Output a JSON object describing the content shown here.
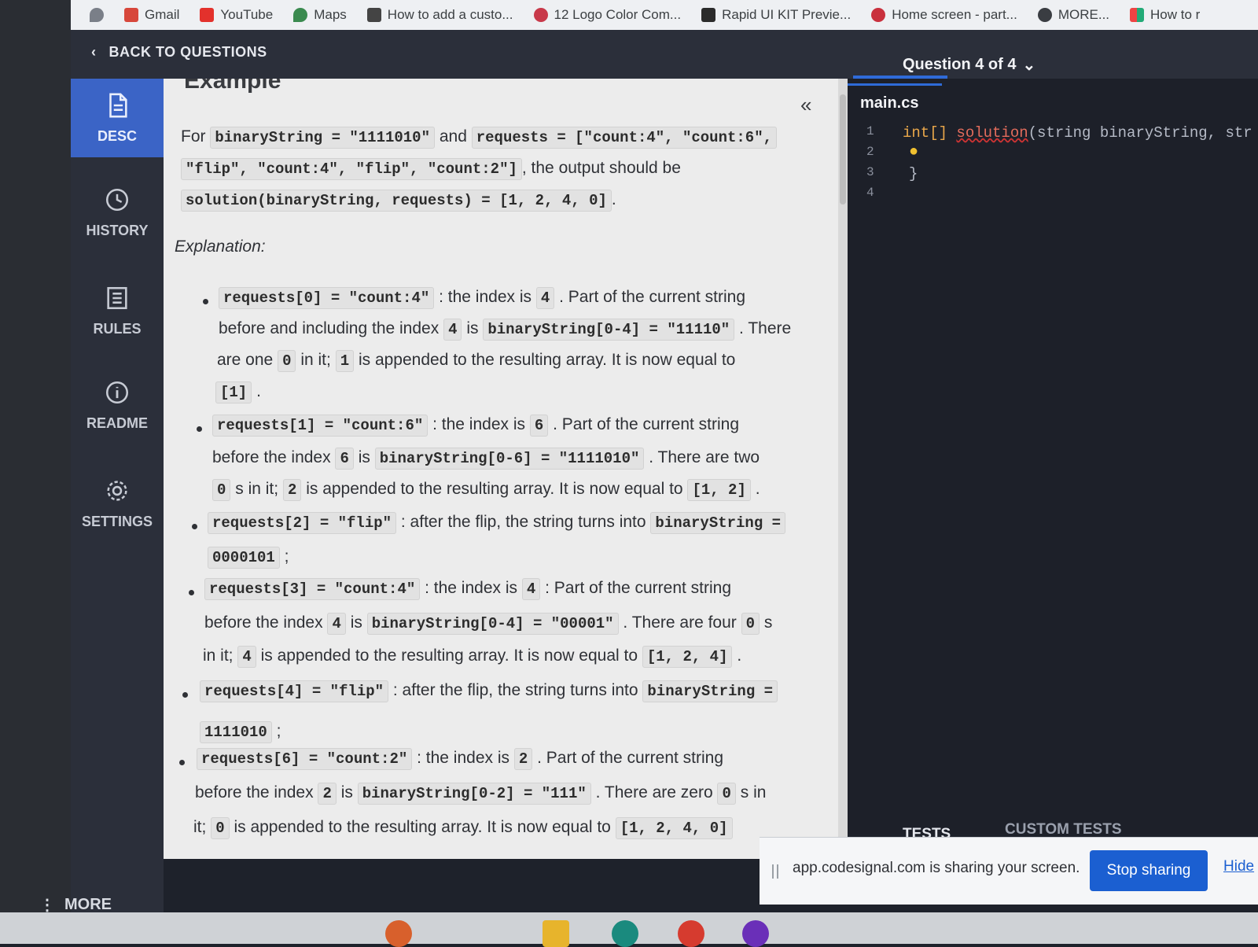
{
  "browser": {
    "bookmarks": [
      "Gmail",
      "YouTube",
      "Maps",
      "How to add a custo...",
      "12 Logo Color Com...",
      "Rapid UI KIT Previe...",
      "Home screen - part...",
      "MORE...",
      "How to r"
    ]
  },
  "topnav": {
    "back_label": "BACK TO QUESTIONS",
    "question_selector": "Question 4 of 4"
  },
  "sidebar": {
    "items": [
      {
        "label": "DESC"
      },
      {
        "label": "HISTORY"
      },
      {
        "label": "RULES"
      },
      {
        "label": "README"
      },
      {
        "label": "SETTINGS"
      }
    ],
    "more_label": "MORE"
  },
  "description": {
    "heading": "Example",
    "intro": {
      "for": "For",
      "code1": "binaryString = \"1111010\"",
      "and": "and",
      "code2": "requests = [\"count:4\", \"count:6\",",
      "code3": "\"flip\", \"count:4\", \"flip\", \"count:2\"]",
      "output_text": ", the output should be",
      "code4": "solution(binaryString, requests) = [1, 2, 4, 0]",
      "period": "."
    },
    "explanation_label": "Explanation:",
    "bullets": [
      {
        "lines": [
          [
            {
              "c": "requests[0] = \"count:4\""
            },
            {
              "t": ": the index is"
            },
            {
              "c": "4"
            },
            {
              "t": ". Part of the current string"
            }
          ],
          [
            {
              "t": "before and including the index"
            },
            {
              "c": "4"
            },
            {
              "t": "is"
            },
            {
              "c": "binaryString[0-4] = \"11110\""
            },
            {
              "t": ". There"
            }
          ],
          [
            {
              "t": "are one"
            },
            {
              "c": "0"
            },
            {
              "t": "in it;"
            },
            {
              "c": "1"
            },
            {
              "t": "is appended to the resulting array. It is now equal to"
            }
          ],
          [
            {
              "c": "[1]"
            },
            {
              "t": "."
            }
          ]
        ]
      },
      {
        "lines": [
          [
            {
              "c": "requests[1] = \"count:6\""
            },
            {
              "t": ": the index is"
            },
            {
              "c": "6"
            },
            {
              "t": ". Part of the current string"
            }
          ],
          [
            {
              "t": "before the index"
            },
            {
              "c": "6"
            },
            {
              "t": "is"
            },
            {
              "c": "binaryString[0-6] = \"1111010\""
            },
            {
              "t": ". There are two"
            }
          ],
          [
            {
              "c": "0"
            },
            {
              "t": "s in it;"
            },
            {
              "c": "2"
            },
            {
              "t": "is appended to the resulting array. It is now equal to"
            },
            {
              "c": "[1, 2]"
            },
            {
              "t": "."
            }
          ]
        ]
      },
      {
        "lines": [
          [
            {
              "c": "requests[2] = \"flip\""
            },
            {
              "t": ": after the flip, the string turns into"
            },
            {
              "c": "binaryString ="
            }
          ],
          [
            {
              "c": "0000101"
            },
            {
              "t": ";"
            }
          ]
        ]
      },
      {
        "lines": [
          [
            {
              "c": "requests[3] = \"count:4\""
            },
            {
              "t": ": the index is"
            },
            {
              "c": "4"
            },
            {
              "t": ": Part of the current string"
            }
          ],
          [
            {
              "t": "before the index"
            },
            {
              "c": "4"
            },
            {
              "t": "is"
            },
            {
              "c": "binaryString[0-4] = \"00001\""
            },
            {
              "t": ". There are four"
            },
            {
              "c": "0"
            },
            {
              "t": "s"
            }
          ],
          [
            {
              "t": "in it;"
            },
            {
              "c": "4"
            },
            {
              "t": "is appended to the resulting array. It is now equal to"
            },
            {
              "c": "[1, 2, 4]"
            },
            {
              "t": "."
            }
          ]
        ]
      },
      {
        "lines": [
          [
            {
              "c": "requests[4] = \"flip\""
            },
            {
              "t": ": after the flip, the string turns into"
            },
            {
              "c": "binaryString ="
            }
          ],
          [
            {
              "c": "1111010"
            },
            {
              "t": ";"
            }
          ]
        ]
      },
      {
        "lines": [
          [
            {
              "c": "requests[6] = \"count:2\""
            },
            {
              "t": ": the index is"
            },
            {
              "c": "2"
            },
            {
              "t": ". Part of the current string"
            }
          ],
          [
            {
              "t": "before the index"
            },
            {
              "c": "2"
            },
            {
              "t": "is"
            },
            {
              "c": "binaryString[0-2] = \"111\""
            },
            {
              "t": ". There are zero"
            },
            {
              "c": "0"
            },
            {
              "t": "s in"
            }
          ],
          [
            {
              "t": "it;"
            },
            {
              "c": "0"
            },
            {
              "t": "is appended to the resulting array. It is now equal to"
            },
            {
              "c": "[1, 2, 4, 0]"
            }
          ]
        ]
      }
    ]
  },
  "editor": {
    "filename": "main.cs",
    "line_numbers": [
      "1",
      "2",
      "3",
      "4"
    ],
    "code_line1_type": "int[]",
    "code_line1_fn": "solution",
    "code_line1_rest": "(string binaryString, str",
    "code_line3": "}",
    "tests_tab": "TESTS",
    "custom_tests_tab": "CUSTOM TESTS"
  },
  "share_bar": {
    "message": "app.codesignal.com is sharing your screen.",
    "stop_label": "Stop sharing",
    "hide_label": "Hide"
  },
  "colors": {
    "accent_blue": "#3b64c6",
    "editor_keyword": "#e8a64a",
    "editor_fn": "#e46c5c",
    "editor_text": "#b5bac6"
  }
}
